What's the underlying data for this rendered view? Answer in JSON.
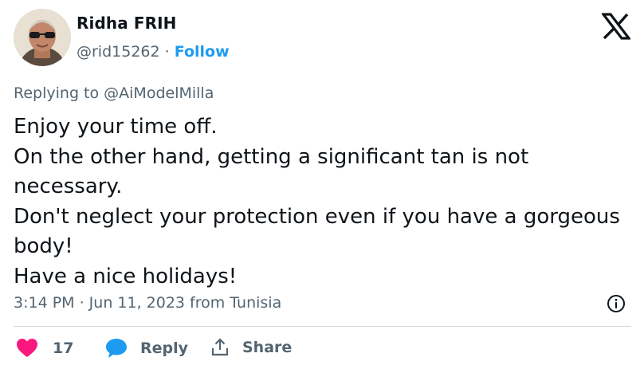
{
  "author": {
    "display_name": "Ridha FRIH",
    "handle": "@rid15262",
    "separator": "·",
    "follow_label": "Follow",
    "avatar_icon": "avatar-photo"
  },
  "brand": {
    "logo_icon": "x-logo-icon"
  },
  "reply_context": "Replying to @AiModelMilla",
  "tweet": {
    "lines": [
      "Enjoy your time off.",
      "On the other hand, getting a significant tan is not",
      "necessary.",
      "Don't neglect your protection even if you have a gorgeous",
      "body!",
      "Have a nice holidays!"
    ]
  },
  "meta": {
    "timestamp": "3:14 PM · Jun 11, 2023 from Tunisia",
    "info_icon": "info-icon"
  },
  "actions": {
    "like_count": "17",
    "reply_label": "Reply",
    "share_label": "Share"
  },
  "colors": {
    "text_primary": "#0f1419",
    "text_secondary": "#536471",
    "link": "#1d9bf0",
    "like": "#f91880",
    "divider": "#cfd9de"
  }
}
